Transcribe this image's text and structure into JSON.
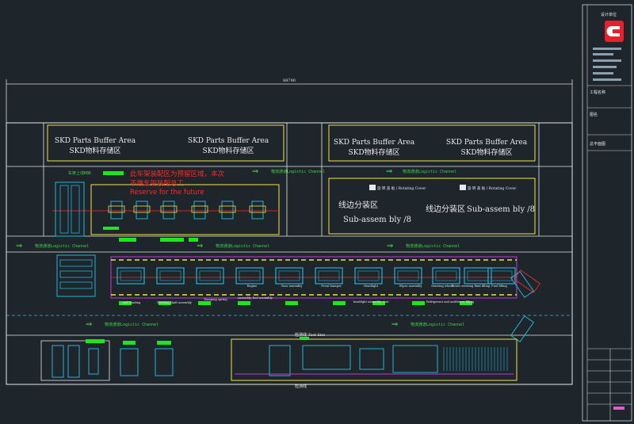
{
  "drawing": {
    "overall_dimension": "88790",
    "buffer_areas": [
      {
        "en": "SKD Parts Buffer Area",
        "cn": "SKD物料存储区"
      },
      {
        "en": "SKD Parts Buffer Area",
        "cn": "SKD物料存储区"
      },
      {
        "en": "SKD Parts Buffer Area",
        "cn": "SKD物料存储区"
      },
      {
        "en": "SKD Parts Buffer Area",
        "cn": "SKD物料存储区"
      }
    ],
    "logistic_channel": "物流通道Logistic Channel",
    "kbk_label": "车架上线KBK",
    "reserved_note": {
      "line1": "此车架装配区为预留区域，本次",
      "line2": "不做车架装配总工",
      "line3": "Reserve for the future"
    },
    "sub_assembly": [
      {
        "cn": "线边分装区",
        "en": "Sub-assem bly /8"
      },
      {
        "cn": "线边分装区",
        "en": "Sub-assem bly /8"
      }
    ],
    "rotating_cover": "旋 转 盖 板 / Rotating Cover",
    "station_labels": [
      "Engine",
      "Gear assembly",
      "Front bumper",
      "Headlight",
      "Wiper assembly",
      "Steering wheel",
      "Power steering fluid filling",
      "Fuel filling"
    ],
    "lower_labels": [
      "and bonding",
      "Rotating shaft assembly",
      "Damping spring",
      "assembly, fuel assembly",
      "headlight assembly, seat",
      "Refrigerant and antifreeze filling"
    ],
    "test_line": "检测线 Test line",
    "inspection_line": "检测线",
    "title_block": {
      "company": "设计单位",
      "project": "工程名称",
      "drawing": "图名",
      "drawing_no": "总平面图"
    }
  },
  "colors": {
    "background": "#1e252b",
    "outline": "#e6e6e6",
    "buffer": "#f2e24a",
    "logistic": "#43d64a",
    "conveyor": "#22b5d6",
    "accent": "#c23ad8",
    "note": "#ff2a2a",
    "logo": "#e8202a"
  }
}
